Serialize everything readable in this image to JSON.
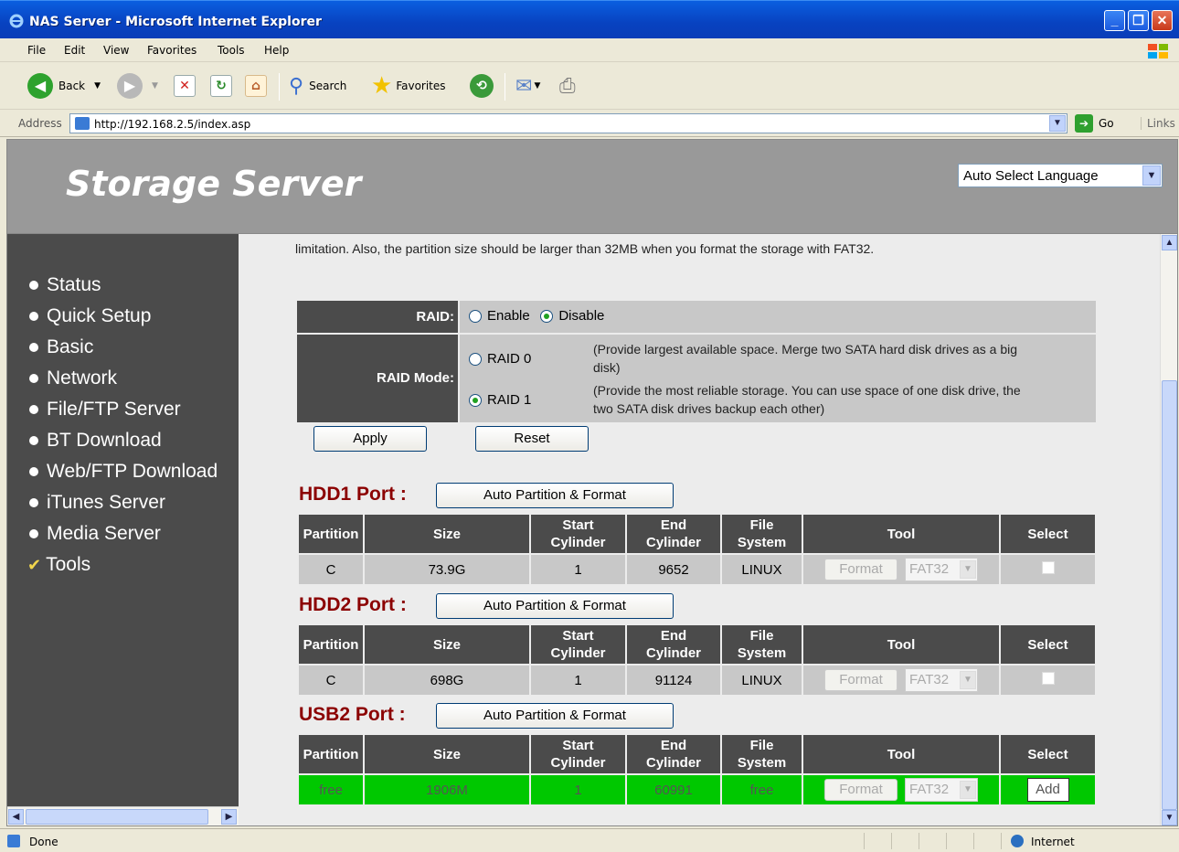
{
  "window": {
    "title": "NAS Server - Microsoft Internet Explorer"
  },
  "menu": [
    "File",
    "Edit",
    "View",
    "Favorites",
    "Tools",
    "Help"
  ],
  "toolbar": {
    "back": "Back",
    "search": "Search",
    "favorites": "Favorites"
  },
  "address": {
    "label": "Address",
    "url": "http://192.168.2.5/index.asp",
    "go": "Go",
    "links": "Links"
  },
  "header": {
    "brand": "Storage Server",
    "language": "Auto Select Language"
  },
  "sidebar": {
    "items": [
      "Status",
      "Quick Setup",
      "Basic",
      "Network",
      "File/FTP Server",
      "BT Download",
      "Web/FTP Download",
      "iTunes Server",
      "Media Server",
      "Tools"
    ]
  },
  "main": {
    "intro": "limitation. Also, the partition size should be larger than 32MB when you format the storage with FAT32.",
    "raid": {
      "label": "RAID:",
      "enable": "Enable",
      "disable": "Disable",
      "selected": "Disable",
      "mode_label": "RAID Mode:",
      "raid0": "RAID 0",
      "raid0_desc_1": "(Provide largest available space. Merge two SATA hard disk drives as a big",
      "raid0_desc_2": "disk)",
      "raid1": "RAID 1",
      "raid1_desc_1": "(Provide the most reliable storage. You can use space of one disk drive, the",
      "raid1_desc_2": "two SATA disk drives backup each other)",
      "mode_selected": "RAID 1"
    },
    "apply": "Apply",
    "reset": "Reset",
    "auto_partition": "Auto Partition & Format",
    "columns": {
      "partition": "Partition",
      "size": "Size",
      "start1": "Start",
      "start2": "Cylinder",
      "end1": "End",
      "end2": "Cylinder",
      "fs1": "File",
      "fs2": "System",
      "tool": "Tool",
      "select": "Select"
    },
    "format_label": "Format",
    "add_label": "Add",
    "ports": [
      {
        "title": "HDD1 Port :",
        "row": {
          "partition": "C",
          "size": "73.9G",
          "start": "1",
          "end": "9652",
          "fs": "LINUX",
          "fmt": "FAT32"
        }
      },
      {
        "title": "HDD2 Port :",
        "row": {
          "partition": "C",
          "size": "698G",
          "start": "1",
          "end": "91124",
          "fs": "LINUX",
          "fmt": "FAT32"
        }
      },
      {
        "title": "USB2 Port :",
        "row": {
          "partition": "free",
          "size": "1906M",
          "start": "1",
          "end": "60991",
          "fs": "free",
          "fmt": "FAT32"
        }
      }
    ]
  },
  "status": {
    "text": "Done",
    "zone": "Internet"
  },
  "colors": {
    "sidebar": "#4b4b4b",
    "header": "#999999",
    "port_title": "#8b0000",
    "free_row": "#00c800"
  }
}
